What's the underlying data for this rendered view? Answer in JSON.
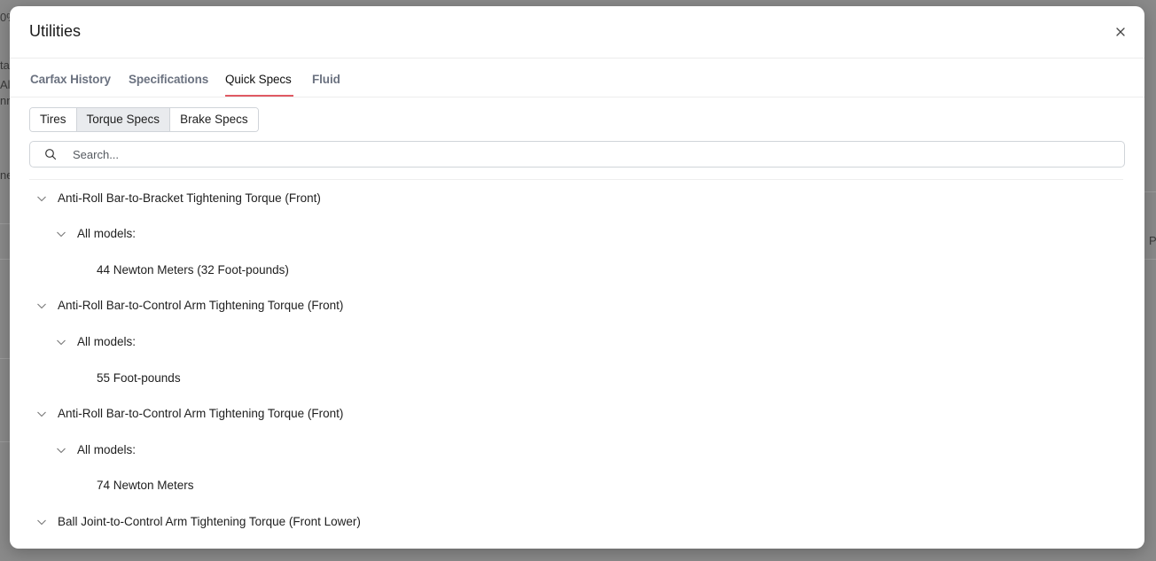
{
  "modal": {
    "title": "Utilities",
    "close_label": "×"
  },
  "tabs": [
    {
      "label": "Carfax History",
      "active": false
    },
    {
      "label": "Specifications",
      "active": false
    },
    {
      "label": "Quick Specs",
      "active": true
    },
    {
      "label": "Fluid",
      "active": false
    }
  ],
  "segments": [
    {
      "label": "Tires",
      "active": false
    },
    {
      "label": "Torque Specs",
      "active": true
    },
    {
      "label": "Brake Specs",
      "active": false
    }
  ],
  "search": {
    "placeholder": "Search..."
  },
  "specs": [
    {
      "title": "Anti-Roll Bar-to-Bracket Tightening Torque (Front)",
      "group": "All models:",
      "value": "44 Newton Meters (32 Foot-pounds)"
    },
    {
      "title": "Anti-Roll Bar-to-Control Arm Tightening Torque (Front)",
      "group": "All models:",
      "value": "55 Foot-pounds"
    },
    {
      "title": "Anti-Roll Bar-to-Control Arm Tightening Torque (Front)",
      "group": "All models:",
      "value": "74 Newton Meters"
    },
    {
      "title": "Ball Joint-to-Control Arm Tightening Torque (Front Lower)",
      "group": "",
      "value": ""
    }
  ],
  "colors": {
    "accent": "#e05a63",
    "overlay": "#8a8a8a"
  }
}
